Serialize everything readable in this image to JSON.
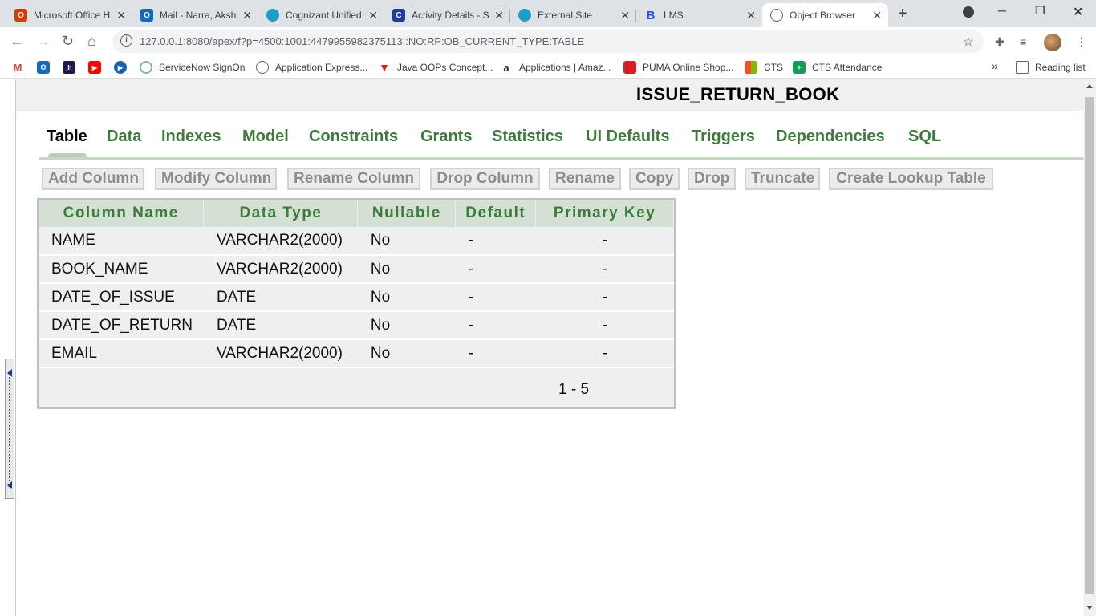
{
  "browser": {
    "tabs": [
      {
        "title": "Microsoft Office H",
        "icon": "office-icon",
        "color": "#d83b01",
        "active": false
      },
      {
        "title": "Mail - Narra, Aksh",
        "icon": "outlook-icon",
        "color": "#0f6cbd",
        "active": false
      },
      {
        "title": "Cognizant Unified",
        "icon": "cognizant-icon",
        "color": "#1aa0c8",
        "active": false
      },
      {
        "title": "Activity Details - S",
        "icon": "c-icon",
        "color": "#1b3d9e",
        "active": false
      },
      {
        "title": "External Site",
        "icon": "globe-icon",
        "color": "#1aa0c8",
        "active": false
      },
      {
        "title": "LMS",
        "icon": "b-icon",
        "color": "#2b4fd8",
        "active": false
      },
      {
        "title": "Object Browser",
        "icon": "globe-icon",
        "color": "#5f6368",
        "active": true
      }
    ],
    "url": "127.0.0.1:8080/apex/f?p=4500:1001:4479955982375113::NO:RP:OB_CURRENT_TYPE:TABLE",
    "bookmarks": [
      {
        "label": "",
        "icon": "gmail-icon",
        "color": "#ea4335"
      },
      {
        "label": "",
        "icon": "outlook-icon",
        "color": "#0f6cbd"
      },
      {
        "label": "",
        "icon": "jh-icon",
        "color": "#1b1b4f"
      },
      {
        "label": "",
        "icon": "youtube-icon",
        "color": "#ff0000"
      },
      {
        "label": "",
        "icon": "play-icon",
        "color": "#1a5fb4"
      },
      {
        "label": "ServiceNow SignOn",
        "icon": "servicenow-icon",
        "color": "#81b5a1"
      },
      {
        "label": "Application Express...",
        "icon": "globe-icon",
        "color": "#5f6368"
      },
      {
        "label": "Java OOPs Concept...",
        "icon": "javatpoint-icon",
        "color": "#e0201b"
      },
      {
        "label": "Applications | Amaz...",
        "icon": "amazon-icon",
        "color": "#232f3e"
      },
      {
        "label": "PUMA Online Shop...",
        "icon": "puma-icon",
        "color": "#d81f26"
      },
      {
        "label": "CTS",
        "icon": "ms-icon",
        "color": "#f25022"
      },
      {
        "label": "CTS Attendance",
        "icon": "sheets-icon",
        "color": "#0f9d58"
      }
    ],
    "reading_list": "Reading list"
  },
  "page": {
    "title": "ISSUE_RETURN_BOOK",
    "tabs": [
      "Table",
      "Data",
      "Indexes",
      "Model",
      "Constraints",
      "Grants",
      "Statistics",
      "UI Defaults",
      "Triggers",
      "Dependencies",
      "SQL"
    ],
    "active_tab": "Table",
    "actions": [
      "Add Column",
      "Modify Column",
      "Rename Column",
      "Drop Column",
      "Rename",
      "Copy",
      "Drop",
      "Truncate",
      "Create Lookup Table"
    ],
    "columns": {
      "headers": [
        "Column Name",
        "Data Type",
        "Nullable",
        "Default",
        "Primary Key"
      ],
      "rows": [
        [
          "NAME",
          "VARCHAR2(2000)",
          "No",
          "-",
          "-"
        ],
        [
          "BOOK_NAME",
          "VARCHAR2(2000)",
          "No",
          "-",
          "-"
        ],
        [
          "DATE_OF_ISSUE",
          "DATE",
          "No",
          "-",
          "-"
        ],
        [
          "DATE_OF_RETURN",
          "DATE",
          "No",
          "-",
          "-"
        ],
        [
          "EMAIL",
          "VARCHAR2(2000)",
          "No",
          "-",
          "-"
        ]
      ],
      "pagination": "1 - 5"
    },
    "accent_green": "#3d7a3d"
  }
}
